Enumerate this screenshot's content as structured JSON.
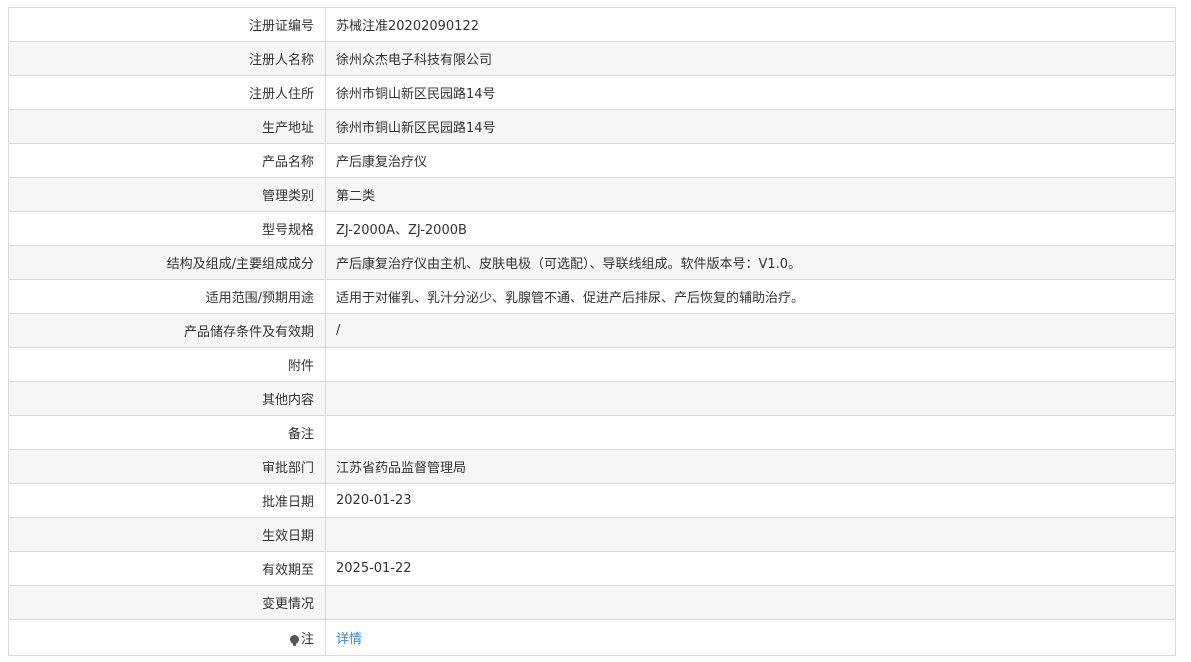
{
  "rows": [
    {
      "label": "注册证编号",
      "value": "苏械注准20202090122"
    },
    {
      "label": "注册人名称",
      "value": "徐州众杰电子科技有限公司"
    },
    {
      "label": "注册人住所",
      "value": "徐州市铜山新区民园路14号"
    },
    {
      "label": "生产地址",
      "value": "徐州市铜山新区民园路14号"
    },
    {
      "label": "产品名称",
      "value": "产后康复治疗仪"
    },
    {
      "label": "管理类别",
      "value": "第二类"
    },
    {
      "label": "型号规格",
      "value": "ZJ-2000A、ZJ-2000B"
    },
    {
      "label": "结构及组成/主要组成成分",
      "value": "产后康复治疗仪由主机、皮肤电极（可选配）、导联线组成。软件版本号：V1.0。"
    },
    {
      "label": "适用范围/预期用途",
      "value": "适用于对催乳、乳汁分泌少、乳腺管不通、促进产后排尿、产后恢复的辅助治疗。"
    },
    {
      "label": "产品储存条件及有效期",
      "value": "/"
    },
    {
      "label": "附件",
      "value": ""
    },
    {
      "label": "其他内容",
      "value": ""
    },
    {
      "label": "备注",
      "value": ""
    },
    {
      "label": "审批部门",
      "value": "江苏省药品监督管理局"
    },
    {
      "label": "批准日期",
      "value": "2020-01-23"
    },
    {
      "label": "生效日期",
      "value": ""
    },
    {
      "label": "有效期至",
      "value": "2025-01-22"
    },
    {
      "label": "变更情况",
      "value": ""
    }
  ],
  "note": {
    "icon": "note-icon",
    "label": "注",
    "link_text": "详情",
    "link_color": "#3a87c8"
  }
}
